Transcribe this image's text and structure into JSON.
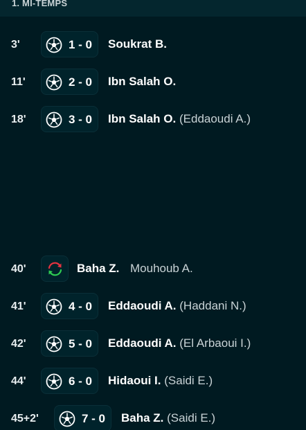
{
  "period": {
    "title": "1. MI-TEMPS"
  },
  "events": [
    {
      "minute": "3'",
      "score": "1 - 0",
      "player": "Soukrat B.",
      "assist": ""
    },
    {
      "minute": "11'",
      "score": "2 - 0",
      "player": "Ibn Salah O.",
      "assist": ""
    },
    {
      "minute": "18'",
      "score": "3 - 0",
      "player": "Ibn Salah O.",
      "assist": "(Eddaoudi A.)"
    },
    {
      "minute": "40'",
      "player_in": "Baha Z.",
      "player_out": "Mouhoub A.",
      "icon": "substitution-icon"
    },
    {
      "minute": "41'",
      "score": "4 - 0",
      "player": "Eddaoudi A.",
      "assist": "(Haddani N.)"
    },
    {
      "minute": "42'",
      "score": "5 - 0",
      "player": "Eddaoudi A.",
      "assist": "(El Arbaoui I.)"
    },
    {
      "minute": "44'",
      "score": "6 - 0",
      "player": "Hidaoui I.",
      "assist": "(Saidi E.)"
    },
    {
      "minute": "45+2'",
      "score": "7 - 0",
      "player": "Baha Z.",
      "assist": "(Saidi E.)"
    }
  ],
  "colors": {
    "background": "#001a21",
    "header": "#04262e",
    "sub_in_arrow": "#2ecc52",
    "sub_out_arrow": "#e63340"
  }
}
